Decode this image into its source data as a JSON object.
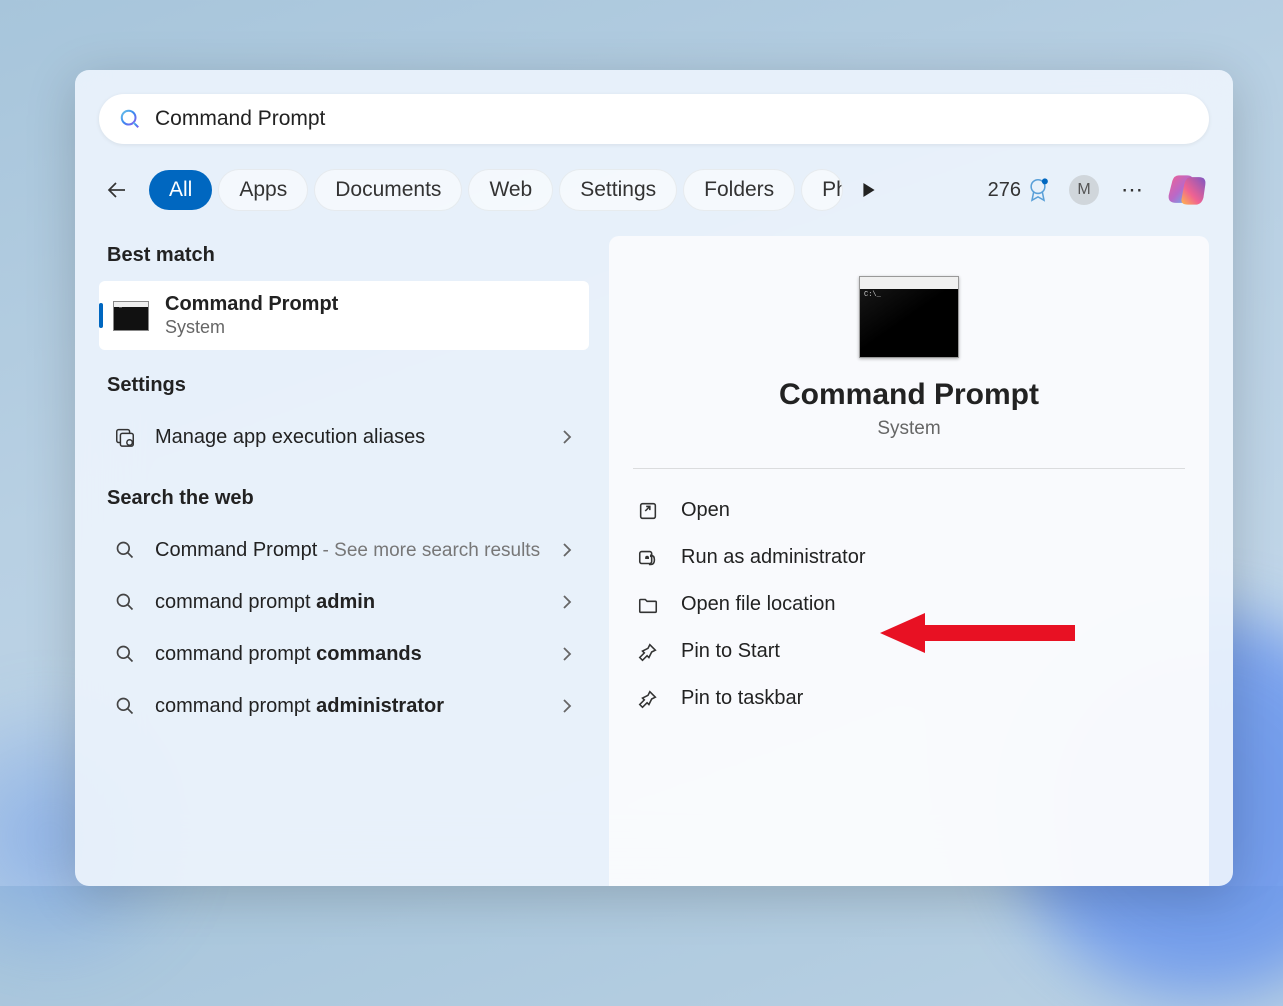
{
  "search": {
    "query": "Command Prompt"
  },
  "tabs": {
    "items": [
      "All",
      "Apps",
      "Documents",
      "Web",
      "Settings",
      "Folders",
      "Photos"
    ],
    "overflow": "Ph"
  },
  "header": {
    "points": "276",
    "avatar": "M"
  },
  "left": {
    "best_match": {
      "title": "Best match",
      "result": {
        "title": "Command Prompt",
        "sub": "System"
      }
    },
    "settings": {
      "title": "Settings",
      "items": [
        {
          "label": "Manage app execution aliases"
        }
      ]
    },
    "web": {
      "title": "Search the web",
      "items": [
        {
          "prefix": "Command Prompt",
          "suffix": " - See more search results"
        },
        {
          "prefix": "command prompt ",
          "bold": "admin"
        },
        {
          "prefix": "command prompt ",
          "bold": "commands"
        },
        {
          "prefix": "command prompt ",
          "bold": "administrator"
        }
      ]
    }
  },
  "right": {
    "title": "Command Prompt",
    "sub": "System",
    "actions": [
      {
        "id": "open",
        "label": "Open"
      },
      {
        "id": "run-admin",
        "label": "Run as administrator"
      },
      {
        "id": "open-location",
        "label": "Open file location"
      },
      {
        "id": "pin-start",
        "label": "Pin to Start"
      },
      {
        "id": "pin-taskbar",
        "label": "Pin to taskbar"
      }
    ]
  }
}
